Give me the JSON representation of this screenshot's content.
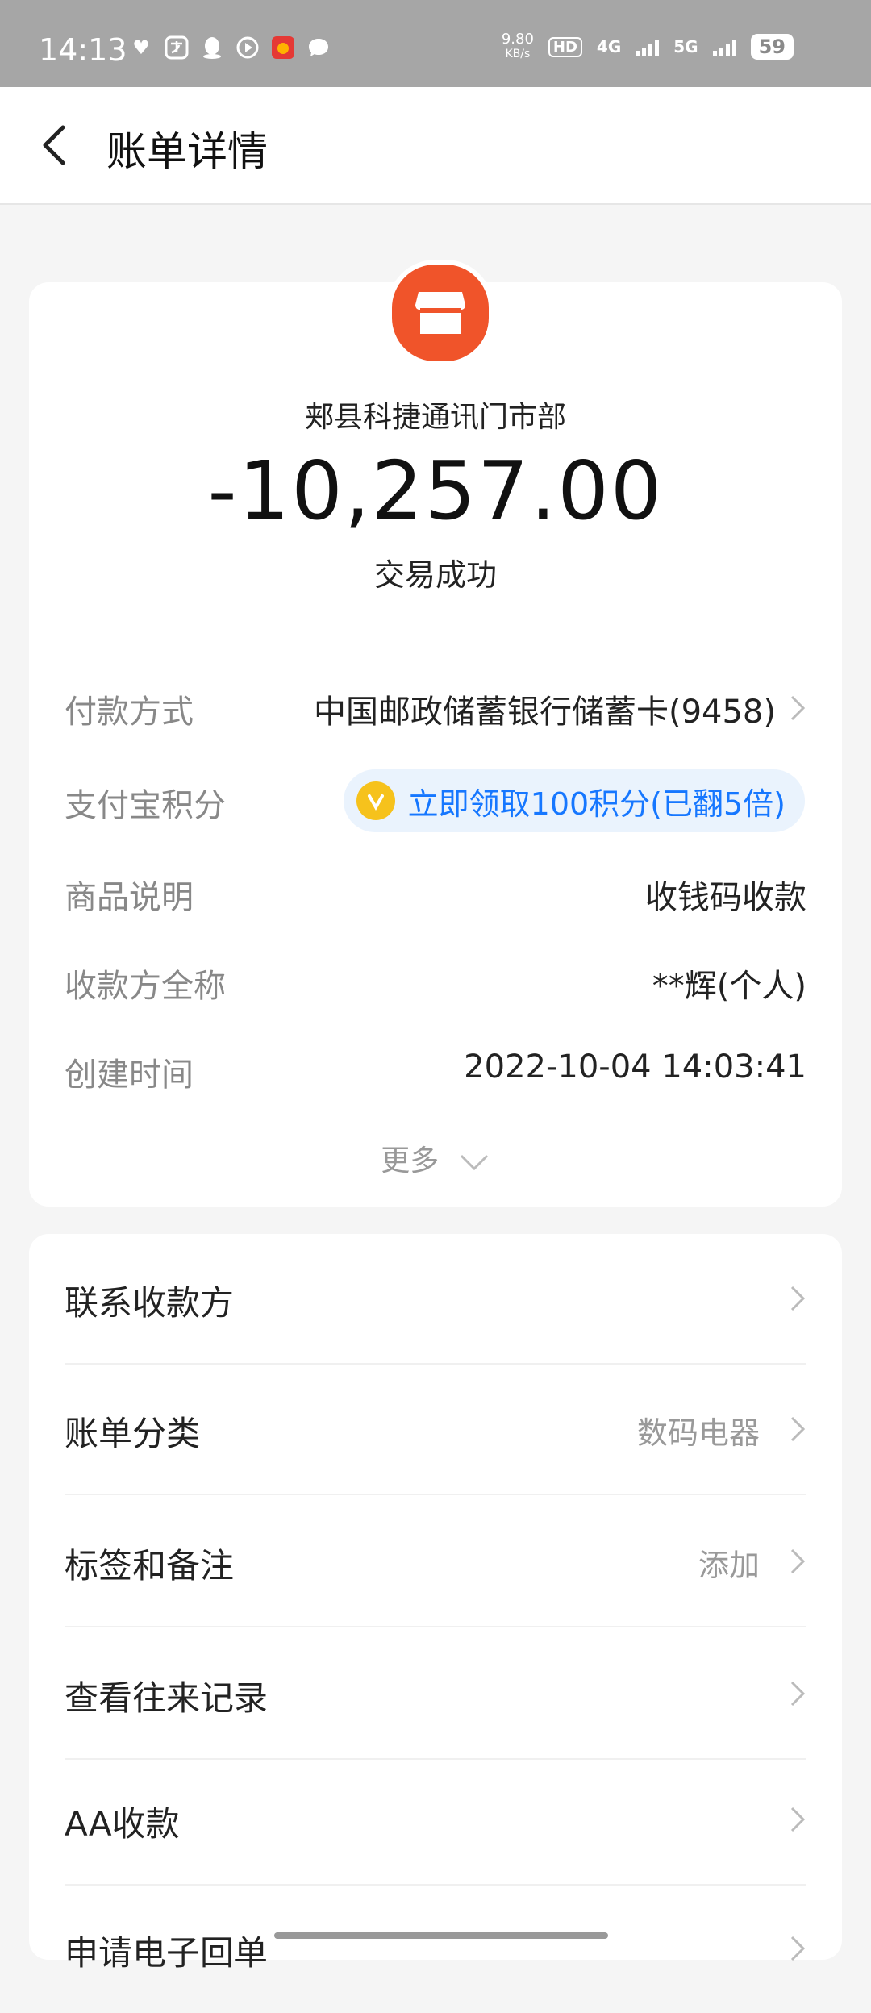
{
  "status_bar": {
    "time": "14:13",
    "net_speed_value": "9.80",
    "net_speed_unit": "KB/s",
    "hd_label": "HD",
    "net1": "4G",
    "net2": "5G",
    "battery": "59"
  },
  "header": {
    "title": "账单详情"
  },
  "transaction": {
    "merchant": "郏县科捷通讯门市部",
    "amount": "-10,257.00",
    "status": "交易成功"
  },
  "details": {
    "payment_method": {
      "label": "付款方式",
      "value": "中国邮政储蓄银行储蓄卡(9458)"
    },
    "points": {
      "label": "支付宝积分",
      "value": "立即领取100积分(已翻5倍)"
    },
    "item_desc": {
      "label": "商品说明",
      "value": "收钱码收款"
    },
    "payee": {
      "label": "收款方全称",
      "value": "**辉(个人)"
    },
    "created": {
      "label": "创建时间",
      "value": "2022-10-04 14:03:41"
    },
    "more": "更多"
  },
  "actions": [
    {
      "label": "联系收款方",
      "value": ""
    },
    {
      "label": "账单分类",
      "value": "数码电器"
    },
    {
      "label": "标签和备注",
      "value": "添加"
    },
    {
      "label": "查看往来记录",
      "value": ""
    },
    {
      "label": "AA收款",
      "value": ""
    },
    {
      "label": "申请电子回单",
      "value": ""
    }
  ],
  "colors": {
    "accent_blue": "#1677ff",
    "shop_orange": "#f0542a"
  }
}
